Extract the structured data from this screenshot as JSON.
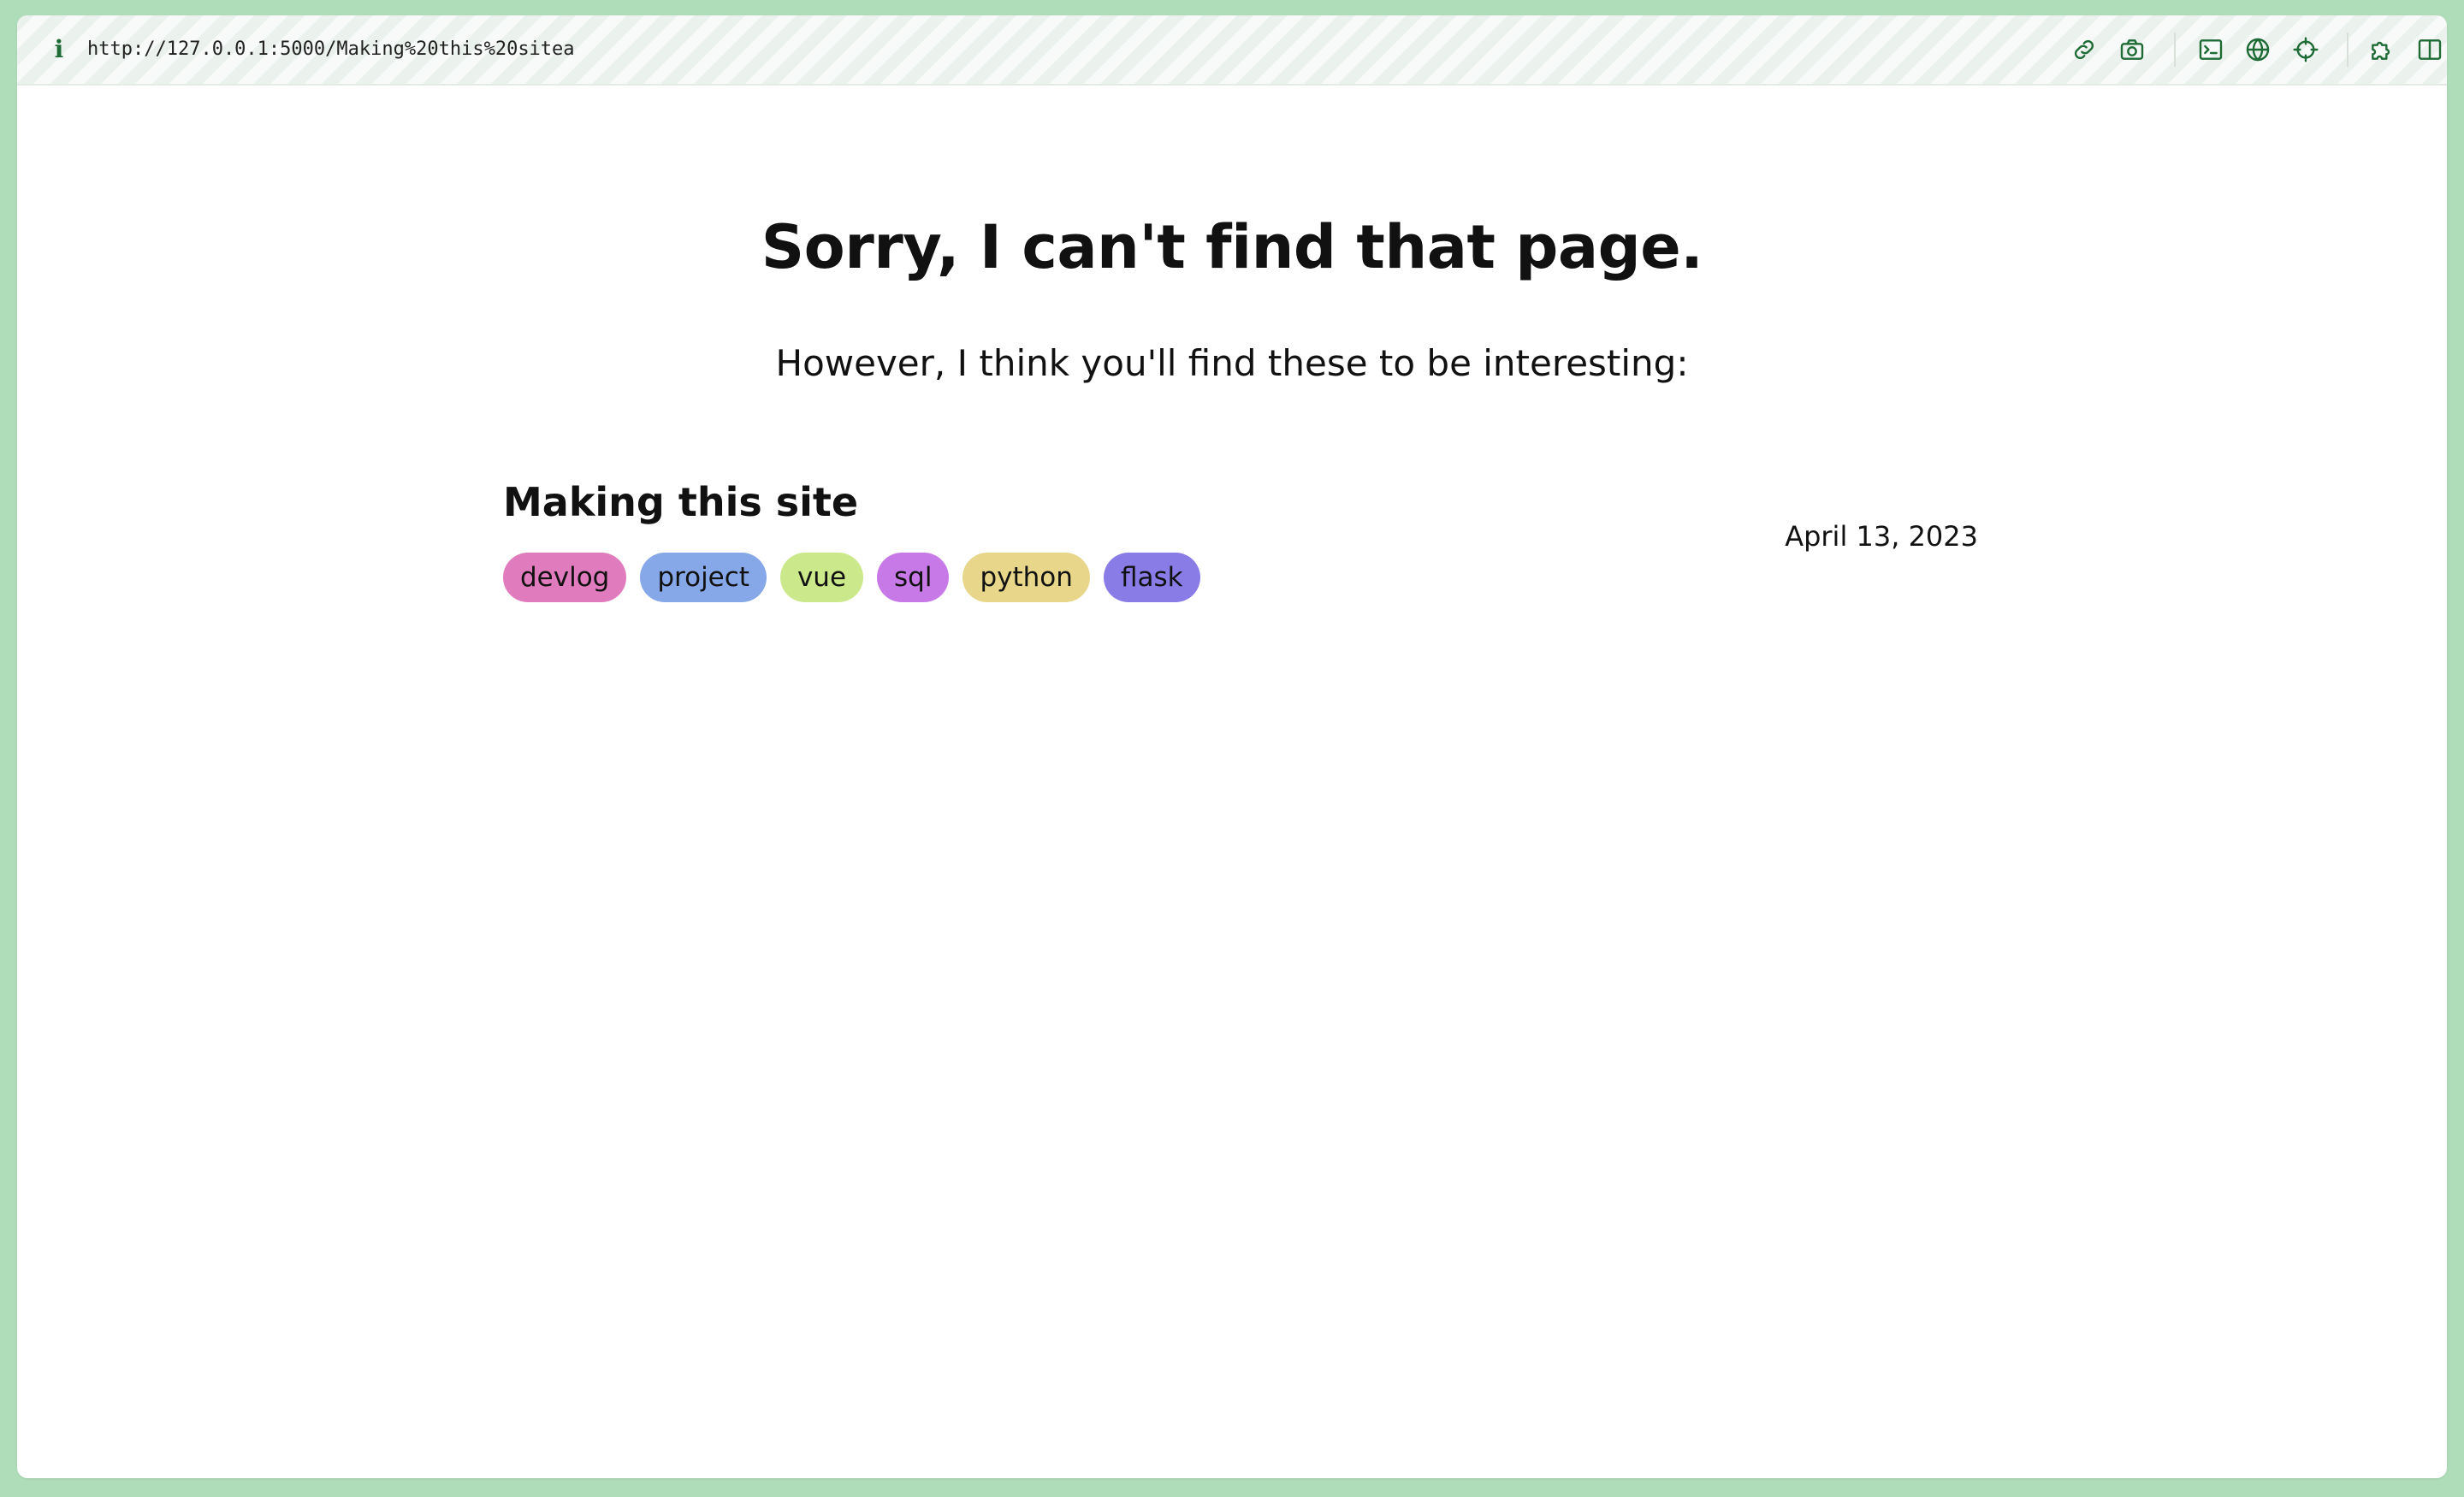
{
  "browser": {
    "url": "http://127.0.0.1:5000/Making%20this%20sitea",
    "info_glyph": "i",
    "toolbar_icons": [
      "link-icon",
      "camera-icon",
      "terminal-icon",
      "globe-icon",
      "crosshair-icon",
      "extension-icon",
      "split-view-icon"
    ],
    "accent_color": "#1e6b36",
    "frame_color": "#afdcb9"
  },
  "page": {
    "title": "Sorry, I can't find that page.",
    "subtitle": "However, I think you'll find these to be interesting:"
  },
  "posts": [
    {
      "title": "Making this site",
      "date": "April 13, 2023",
      "tags": [
        {
          "label": "devlog",
          "color": "#e07bbd"
        },
        {
          "label": "project",
          "color": "#86a8e8"
        },
        {
          "label": "vue",
          "color": "#cbe98a"
        },
        {
          "label": "sql",
          "color": "#c879e8"
        },
        {
          "label": "python",
          "color": "#e8d78a"
        },
        {
          "label": "flask",
          "color": "#8a7ce6"
        }
      ]
    }
  ]
}
